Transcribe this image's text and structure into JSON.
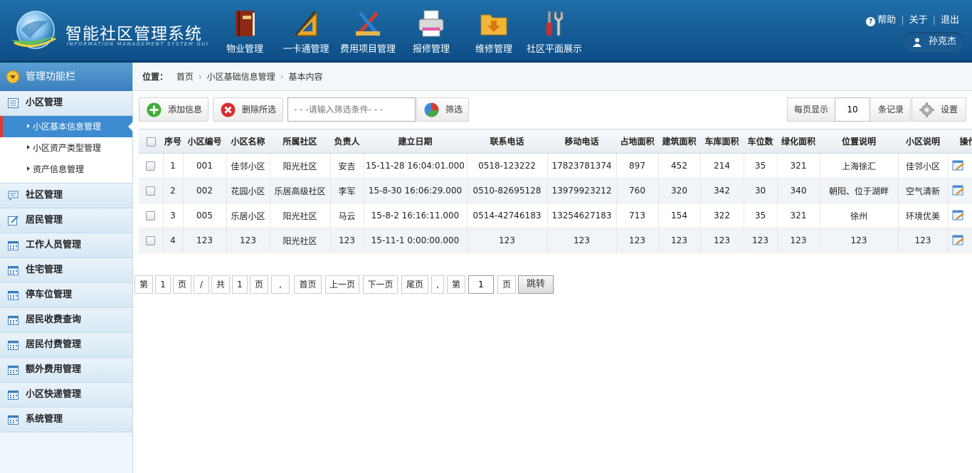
{
  "header": {
    "title": "智能社区管理系统",
    "subtitle": "INFORMATION MANAGEMENT SYSTEM GUI",
    "nav": [
      {
        "label": "物业管理",
        "icon": "book-icon"
      },
      {
        "label": "一卡通管理",
        "icon": "ruler-triangle-icon"
      },
      {
        "label": "费用项目管理",
        "icon": "pencil-ruler-icon"
      },
      {
        "label": "报修管理",
        "icon": "printer-icon"
      },
      {
        "label": "维修管理",
        "icon": "folder-download-icon"
      },
      {
        "label": "社区平面展示",
        "icon": "tools-icon"
      }
    ],
    "links": {
      "help": "帮助",
      "about": "关于",
      "logout": "退出"
    },
    "user": "孙克杰"
  },
  "sidebar": {
    "title": "管理功能栏",
    "groups": [
      {
        "label": "小区管理",
        "icon": "list-icon",
        "items": [
          "小区基本信息管理",
          "小区资产类型管理",
          "资产信息管理"
        ]
      },
      {
        "label": "社区管理",
        "icon": "chat-icon"
      },
      {
        "label": "居民管理",
        "icon": "edit-icon"
      },
      {
        "label": "工作人员管理",
        "icon": "calendar-icon"
      },
      {
        "label": "住宅管理",
        "icon": "calendar-icon"
      },
      {
        "label": "停车位管理",
        "icon": "calendar-icon"
      },
      {
        "label": "居民收费查询",
        "icon": "calendar-icon"
      },
      {
        "label": "居民付费管理",
        "icon": "calendar-icon"
      },
      {
        "label": "额外费用管理",
        "icon": "calendar-icon"
      },
      {
        "label": "小区快递管理",
        "icon": "calendar-icon"
      },
      {
        "label": "系统管理",
        "icon": "calendar-icon"
      }
    ],
    "active_item": "小区基本信息管理"
  },
  "breadcrumb": {
    "label": "位置：",
    "items": [
      "首页",
      "小区基础信息管理",
      "基本内容"
    ]
  },
  "toolbar": {
    "add": "添加信息",
    "delete": "删除所选",
    "filter_placeholder": "- - -请输入筛选条件- - -",
    "filter": "筛选",
    "per_page_label": "每页显示",
    "per_page_value": "10",
    "per_page_suffix": "条记录",
    "settings": "设置"
  },
  "table": {
    "columns": [
      "序号",
      "小区编号",
      "小区名称",
      "所属社区",
      "负责人",
      "建立日期",
      "联系电话",
      "移动电话",
      "占地面积",
      "建筑面积",
      "车库面积",
      "车位数",
      "绿化面积",
      "位置说明",
      "小区说明",
      "操作"
    ],
    "rows": [
      [
        "1",
        "001",
        "佳邻小区",
        "阳光社区",
        "安吉",
        "15-11-28 16:04:01.000",
        "0518-123222",
        "17823781374",
        "897",
        "452",
        "214",
        "35",
        "321",
        "上海徐汇",
        "佳邻小区"
      ],
      [
        "2",
        "002",
        "花园小区",
        "乐居高级社区",
        "李军",
        "15-8-30 16:06:29.000",
        "0510-82695128",
        "13979923212",
        "760",
        "320",
        "342",
        "30",
        "340",
        "朝阳、位于湖畔",
        "空气清新"
      ],
      [
        "3",
        "005",
        "乐居小区",
        "阳光社区",
        "马云",
        "15-8-2 16:16:11.000",
        "0514-42746183",
        "13254627183",
        "713",
        "154",
        "322",
        "35",
        "321",
        "徐州",
        "环境优美"
      ],
      [
        "4",
        "123",
        "123",
        "阳光社区",
        "123",
        "15-11-1 0:00:00.000",
        "123",
        "123",
        "123",
        "123",
        "123",
        "123",
        "123",
        "123",
        "123"
      ]
    ]
  },
  "pager": {
    "di": "第",
    "page": "1",
    "ye": "页",
    "slash": "/",
    "gong": "共",
    "total": "1",
    "comma": ",",
    "first": "首页",
    "prev": "上一页",
    "next": "下一页",
    "last": "尾页",
    "goto_value": "1",
    "go": "跳转"
  }
}
